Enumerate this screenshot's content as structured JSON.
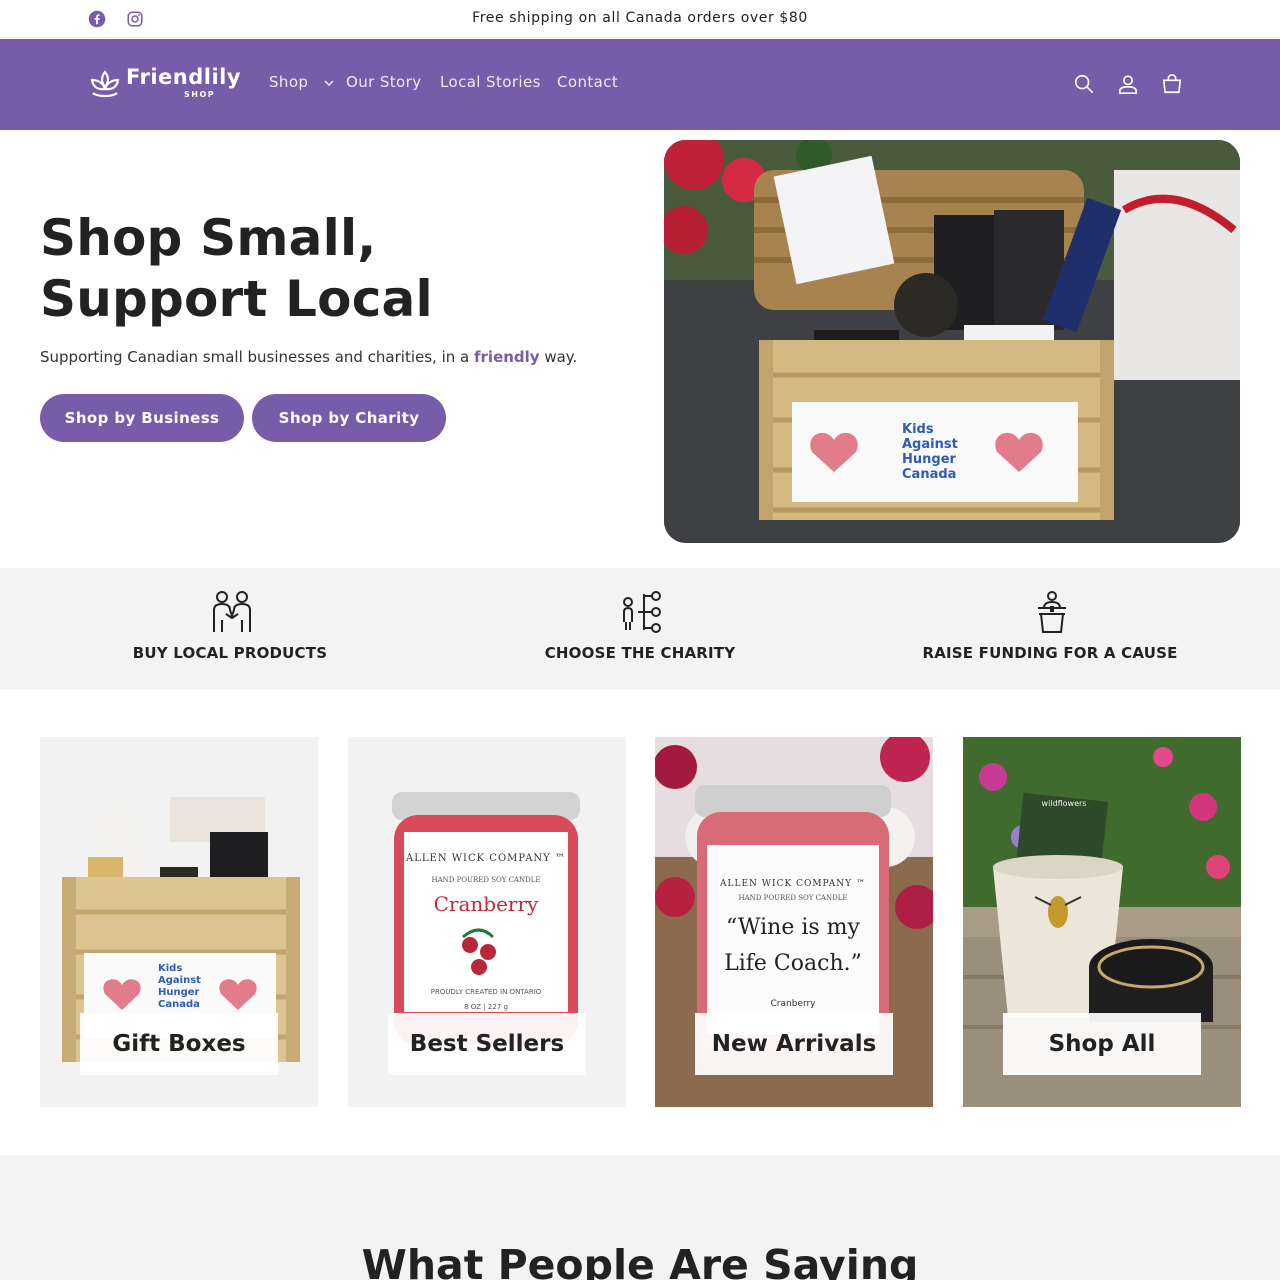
{
  "announcement": {
    "message": "Free shipping on all Canada orders over $80"
  },
  "social": [
    {
      "name": "facebook-icon"
    },
    {
      "name": "instagram-icon"
    }
  ],
  "header": {
    "logo_text": "Friendlily",
    "logo_sub": "SHOP",
    "nav": [
      "Shop",
      "Our Story",
      "Local Stories",
      "Contact"
    ],
    "icons": [
      "search-icon",
      "account-icon",
      "cart-icon"
    ]
  },
  "hero": {
    "title": "Shop Small, Support Local",
    "subtitle_pre": "Supporting Canadian small businesses and charities, in a ",
    "subtitle_highlight": "friendly",
    "subtitle_post": " way.",
    "buttons": [
      "Shop by Business",
      "Shop by Charity"
    ],
    "image_banner_text": "Kids Against Hunger Canada"
  },
  "features": [
    {
      "label": "BUY LOCAL PRODUCTS",
      "icon": "handshake-people-icon"
    },
    {
      "label": "CHOOSE THE CHARITY",
      "icon": "choice-tree-icon"
    },
    {
      "label": "RAISE FUNDING FOR A CAUSE",
      "icon": "donation-box-icon"
    }
  ],
  "collections": [
    {
      "label": "Gift Boxes"
    },
    {
      "label": "Best Sellers"
    },
    {
      "label": "New Arrivals"
    },
    {
      "label": "Shop All"
    }
  ],
  "product_text": {
    "candle_brand": "ALLEN WICK COMPANY ™",
    "candle_type": "HAND POURED SOY CANDLE",
    "candle_1_name": "Cranberry",
    "candle_1_footer": "PROUDLY CREATED IN ONTARIO",
    "candle_1_weight": "8 OZ | 227 g",
    "candle_2_quote_1": "“Wine is my",
    "candle_2_quote_2": "Life Coach.”",
    "candle_2_scent": "Cranberry",
    "seed_packet": "wildflowers",
    "gift_box_tag": "Kids Against Hunger Canada"
  },
  "testimonials": {
    "heading": "What People Are Saying"
  },
  "colors": {
    "brand": "#775ca9",
    "band": "#f3f3f4"
  }
}
